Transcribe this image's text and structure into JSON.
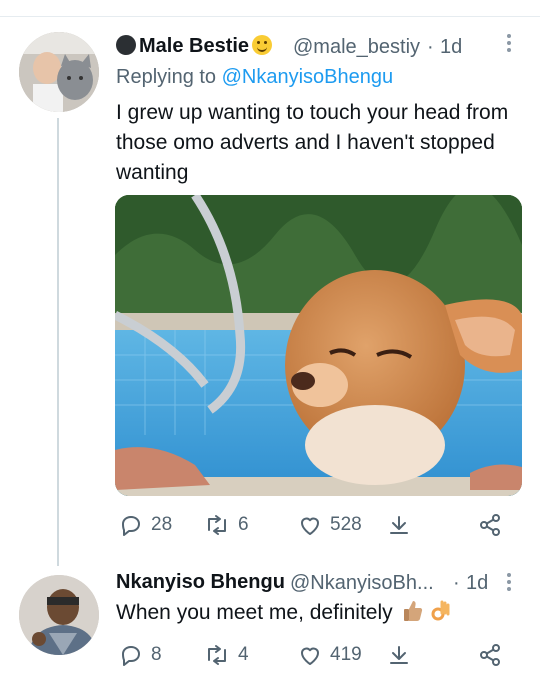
{
  "tweet1": {
    "display_name": "Male Bestie",
    "handle": "@male_bestiy",
    "sep": "·",
    "time": "1d",
    "reply_prefix": "Replying to",
    "reply_handle": "@NkanyisoBhengu",
    "text_lines": [
      "I grew up wanting to touch your head from",
      "those omo adverts and I haven't stopped",
      "wanting"
    ],
    "stats": {
      "replies": "28",
      "retweets": "6",
      "likes": "528"
    }
  },
  "tweet2": {
    "display_name": "Nkanyiso Bhengu",
    "handle": "@NkanyisoBh...",
    "sep": "·",
    "time": "1d",
    "text": "When you meet me, definitely",
    "emojis": [
      "thumbs-up",
      "ok-hand"
    ],
    "stats": {
      "replies": "8",
      "retweets": "4",
      "likes": "419"
    }
  },
  "icons": {
    "reply": "reply-icon",
    "retweet": "retweet-icon",
    "like": "heart-icon",
    "share": "share-icon",
    "more": "more-vertical-icon"
  },
  "colors": {
    "link": "#1d9bf0",
    "muted": "#536471",
    "thread_line": "#cfd9de"
  }
}
